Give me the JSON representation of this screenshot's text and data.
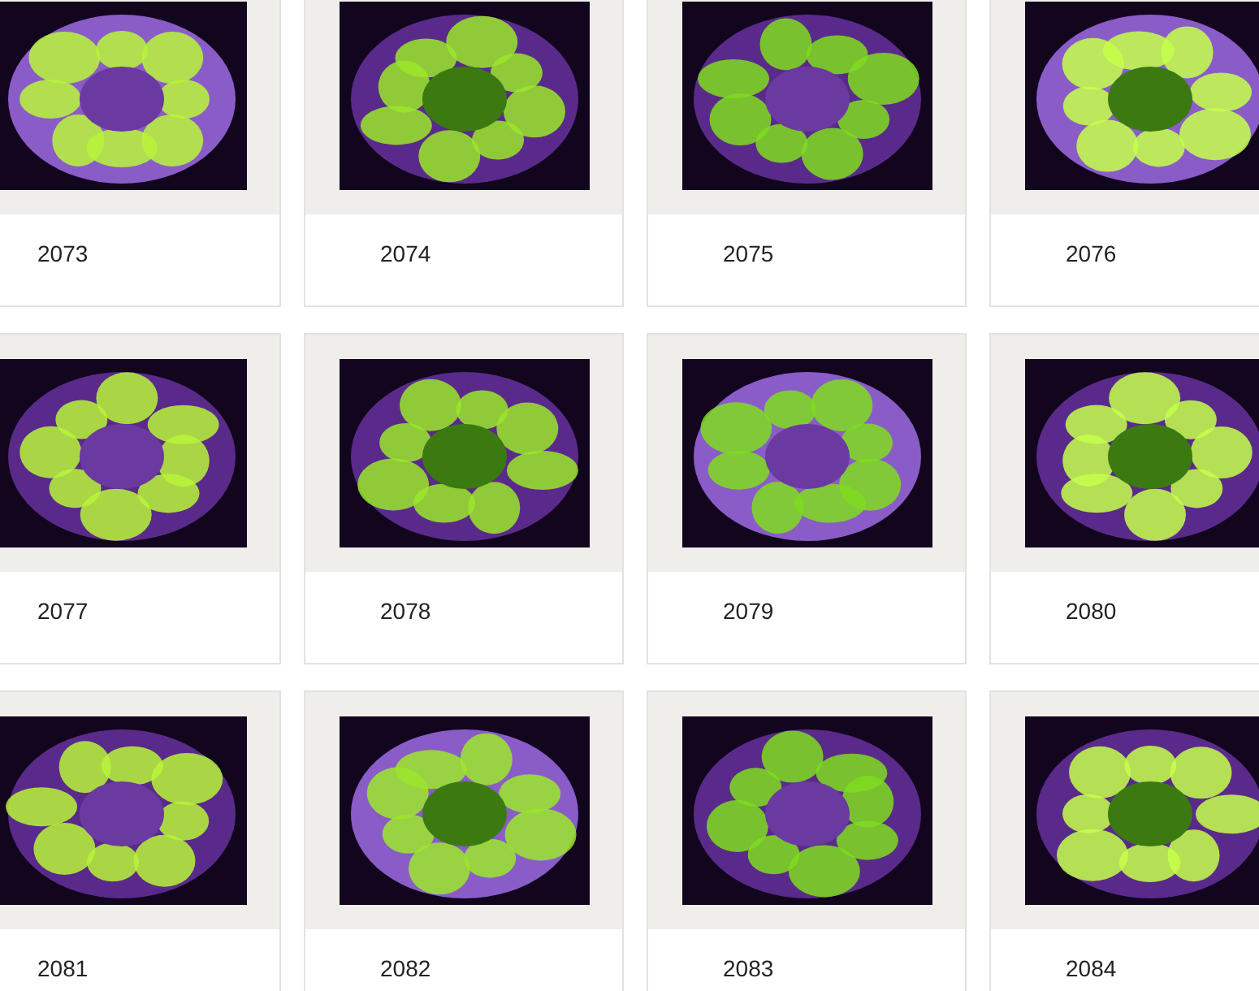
{
  "products": [
    {
      "label": "2073"
    },
    {
      "label": "2074"
    },
    {
      "label": "2075"
    },
    {
      "label": "2076"
    },
    {
      "label": "2077"
    },
    {
      "label": "2078"
    },
    {
      "label": "2079"
    },
    {
      "label": "2080"
    },
    {
      "label": "2081"
    },
    {
      "label": "2082"
    },
    {
      "label": "2083"
    },
    {
      "label": "2084"
    }
  ]
}
